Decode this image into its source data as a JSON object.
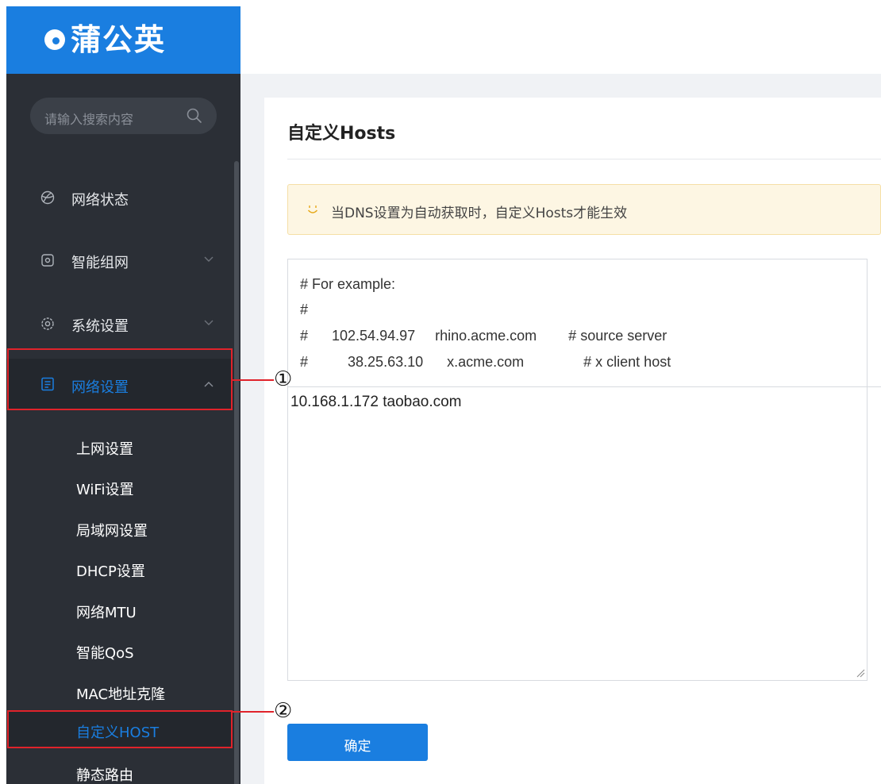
{
  "brand": {
    "name": "蒲公英",
    "color": "#1a7ee0"
  },
  "search": {
    "placeholder": "请输入搜索内容",
    "icon": "search-icon"
  },
  "sidebar": {
    "items": [
      {
        "label": "网络状态",
        "icon": "globe-icon",
        "expandable": false
      },
      {
        "label": "智能组网",
        "icon": "network-icon",
        "expandable": true,
        "expanded": false
      },
      {
        "label": "系统设置",
        "icon": "gear-icon",
        "expandable": true,
        "expanded": false
      },
      {
        "label": "网络设置",
        "icon": "list-icon",
        "expandable": true,
        "expanded": true,
        "active": true
      }
    ],
    "sub_items": [
      {
        "label": "上网设置"
      },
      {
        "label": "WiFi设置"
      },
      {
        "label": "局域网设置"
      },
      {
        "label": "DHCP设置"
      },
      {
        "label": "网络MTU"
      },
      {
        "label": "智能QoS"
      },
      {
        "label": "MAC地址克隆"
      },
      {
        "label": "自定义HOST",
        "current": true
      },
      {
        "label": "静态路由"
      }
    ]
  },
  "main": {
    "title": "自定义Hosts",
    "notice": {
      "icon": "smile-icon",
      "text": "当DNS设置为自动获取时，自定义Hosts才能生效"
    },
    "example": {
      "lines": [
        "# For example:",
        "#",
        "#      102.54.94.97     rhino.acme.com        # source server",
        "#          38.25.63.10      x.acme.com               # x client host"
      ]
    },
    "hosts_value": "10.168.1.172 taobao.com",
    "confirm_label": "确定"
  },
  "annotations": {
    "marker_1": "①",
    "marker_2": "②",
    "color": "#e0232b"
  }
}
